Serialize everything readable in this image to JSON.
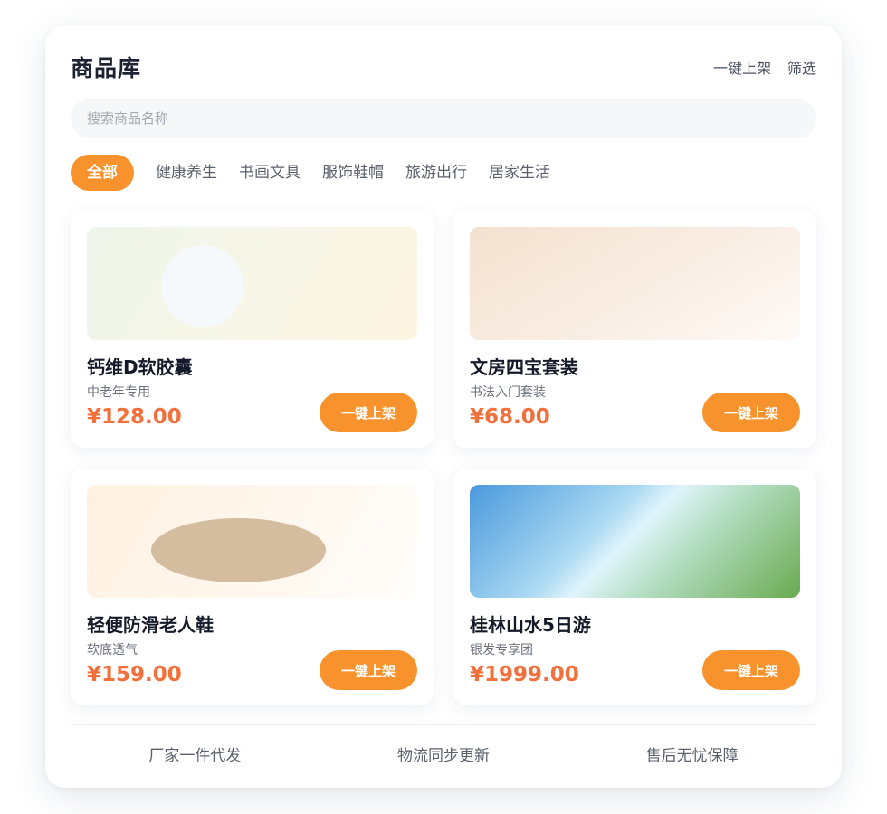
{
  "header": {
    "title": "商品库",
    "action_publish": "一键上架",
    "action_filter": "筛选"
  },
  "search": {
    "placeholder": "搜索商品名称",
    "value": ""
  },
  "tabs": [
    {
      "label": "全部",
      "active": true
    },
    {
      "label": "健康养生",
      "active": false
    },
    {
      "label": "书画文具",
      "active": false
    },
    {
      "label": "服饰鞋帽",
      "active": false
    },
    {
      "label": "旅游出行",
      "active": false
    },
    {
      "label": "居家生活",
      "active": false
    }
  ],
  "products": [
    {
      "name": "钙维D软胶囊",
      "desc": "中老年专用",
      "price": "¥128.00",
      "button": "一键上架"
    },
    {
      "name": "文房四宝套装",
      "desc": "书法入门套装",
      "price": "¥68.00",
      "button": "一键上架"
    },
    {
      "name": "轻便防滑老人鞋",
      "desc": "软底透气",
      "price": "¥159.00",
      "button": "一键上架"
    },
    {
      "name": "桂林山水5日游",
      "desc": "银发专享团",
      "price": "¥1999.00",
      "button": "一键上架"
    }
  ],
  "footer": {
    "item1": "厂家一件代发",
    "item2": "物流同步更新",
    "item3": "售后无忧保障"
  },
  "colors": {
    "accent": "#f7922c",
    "price": "#f2703b",
    "title": "#1d2333"
  }
}
